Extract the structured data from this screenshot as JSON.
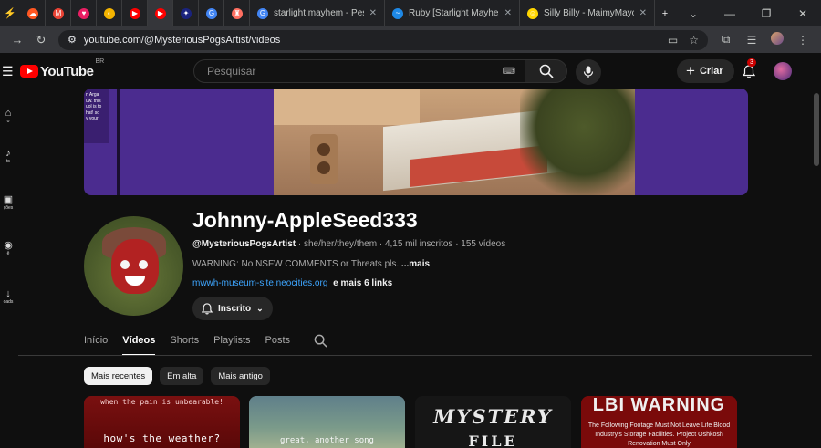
{
  "browser": {
    "tabs": [
      {
        "label": "",
        "color": "#ff5722",
        "glyph": "☁"
      },
      {
        "label": "",
        "color": "#ea4335",
        "glyph": "M"
      },
      {
        "label": "",
        "color": "#e91e63",
        "glyph": "♥"
      },
      {
        "label": "",
        "color": "#f4b400",
        "glyph": "◐"
      },
      {
        "label": "",
        "color": "#ff0000",
        "glyph": "▶"
      },
      {
        "label": "",
        "color": "#ff0000",
        "glyph": "▶"
      },
      {
        "label": "",
        "color": "#1a237e",
        "glyph": "✦"
      },
      {
        "label": "",
        "color": "#4285f4",
        "glyph": "G"
      },
      {
        "label": "",
        "color": "#ff6f61",
        "glyph": "♜"
      },
      {
        "label": "starlight mayhem - Pesquis",
        "color": "#4285f4",
        "glyph": "G"
      },
      {
        "label": "Ruby [Starlight Mayhem] Al",
        "color": "#1e88e5",
        "glyph": "~"
      },
      {
        "label": "Silly Billy - MaimyMayo - Li",
        "color": "#ffd600",
        "glyph": "☺"
      }
    ],
    "new_tab": "+",
    "url": "youtube.com/@MysteriousPogsArtist/videos"
  },
  "header": {
    "logo_text": "YouTube",
    "region": "BR",
    "search_placeholder": "Pesquisar",
    "create_label": "Criar",
    "notif_count": "3"
  },
  "sidebar": {
    "items": [
      {
        "label": "o",
        "glyph": "⌂"
      },
      {
        "label": "ts",
        "glyph": "♪"
      },
      {
        "label": "ções",
        "glyph": "▣"
      },
      {
        "label": "ê",
        "glyph": "◉"
      },
      {
        "label": "oads",
        "glyph": "↓"
      }
    ]
  },
  "banner": {
    "panel_text": "n Arga\nuw. this\nuol is to\nhat! so\ny your"
  },
  "channel": {
    "name": "Johnny-AppleSeed333",
    "handle": "@MysteriousPogsArtist",
    "pronouns": "she/her/they/them",
    "subscribers": "4,15 mil inscritos",
    "videos": "155 vídeos",
    "description": "WARNING: No NSFW COMMENTS or Threats pls.",
    "more": "...mais",
    "link": "mwwh-museum-site.neocities.org",
    "more_links": "e mais 6 links",
    "subscribed_label": "Inscrito"
  },
  "tabs": [
    {
      "label": "Início",
      "active": false
    },
    {
      "label": "Vídeos",
      "active": true
    },
    {
      "label": "Shorts",
      "active": false
    },
    {
      "label": "Playlists",
      "active": false
    },
    {
      "label": "Posts",
      "active": false
    }
  ],
  "chips": [
    {
      "label": "Mais recentes",
      "active": true
    },
    {
      "label": "Em alta",
      "active": false
    },
    {
      "label": "Mais antigo",
      "active": false
    }
  ],
  "videos": [
    {
      "top_text": "when the pain is unbearable!",
      "bottom_text": "how's the weather?"
    },
    {
      "top_text": "",
      "bottom_text": "great, another song"
    },
    {
      "top_text": "MYSTERY",
      "bottom_text": "FILE"
    },
    {
      "top_text": "LBI WARNING",
      "bottom_text": "The Following Footage Must Not Leave Life Blood Industry's Storage Facilities. Project Oshkosh Renovation Must Only"
    }
  ]
}
